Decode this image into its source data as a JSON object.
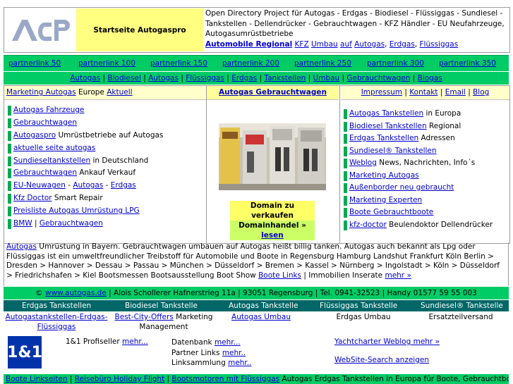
{
  "header": {
    "logo_text": "ACP",
    "start_label": "Startseite Autogaspro",
    "odp_text": "Open Directory Project für Autogas - Erdgas - Biodiesel - Flüssiggas - Sundiesel - Tankstellen - Dellendrücker - Gebrauchtwagen - KFZ Händler - EU Neufahrzeuge, Autogasumrüstbetriebe",
    "odp_links": [
      "Automobile Regional",
      "KFZ",
      "Umbau",
      "auf",
      "Autogas",
      "Erdgas",
      "Flüssiggas"
    ]
  },
  "partners": [
    "partnerlink 50",
    "partnerlink 100",
    "partnerlink 150",
    "partnerlink 200",
    "partnerlink 250",
    "partnerlink 300",
    "partnerlink 350"
  ],
  "categories": [
    "Autogas",
    "Biodiesel",
    "Autogas",
    "Flüssiggas",
    "Erdgas",
    "Tankstellen",
    "Umbau",
    "Gebrauchtwagen",
    "Biogas"
  ],
  "col_heads": {
    "left_link1": "Marketing Autogas",
    "left_text": "Europe",
    "left_link2": "Aktuell",
    "center": "Autogas Gebrauchtwagen",
    "right": [
      "Impressum",
      "Kontakt",
      "Email",
      "Blog"
    ]
  },
  "left_list": [
    {
      "link": "Autogas Fahrzeuge",
      "text": ""
    },
    {
      "link": "Gebrauchtwagen",
      "text": ""
    },
    {
      "link": "Autogaspro",
      "text": " Umrüstbetriebe auf Autogas"
    },
    {
      "link": "aktuelle seite autogas",
      "text": ""
    },
    {
      "link": "Sundieseltankstellen",
      "text": " in Deutschland"
    },
    {
      "link": "Gebrauchtwagen",
      "text": " Ankauf Verkauf"
    },
    {
      "link": "EU-Neuwagen",
      "text": " - ",
      "link2": "Autogas",
      "text2": " - ",
      "link3": "Erdgas"
    },
    {
      "link": "Kfz Doctor",
      "text": " Smart Repair"
    },
    {
      "link": "Preisliste Autogas Umrüstung LPG",
      "text": ""
    },
    {
      "link": "BMW",
      "text": " | ",
      "link2": "Gebrauchtwagen"
    }
  ],
  "right_list": [
    {
      "link": "Autogas Tankstellen",
      "text": " in Europa"
    },
    {
      "link": "Biodiesel Tankstellen",
      "text": " Regional"
    },
    {
      "link": "Erdgas Tankstellen",
      "text": " Adressen"
    },
    {
      "link": "Sundiesel® Tankstellen",
      "text": ""
    },
    {
      "link": "Weblog",
      "text": " News, Nachrichten, Info´s"
    },
    {
      "link": "Marketing Autogas",
      "text": ""
    },
    {
      "link": "Außenborder neu gebraucht",
      "text": ""
    },
    {
      "link": "Marketing Experten",
      "text": ""
    },
    {
      "link": "Boote Gebrauchtboote",
      "text": ""
    },
    {
      "link": "kfz-doctor",
      "text": " Beulendoktor Dellendrücker"
    }
  ],
  "domain": {
    "line1": "Domain zu verkaufen",
    "line2": "Domainhandel",
    "line2_arrow": "»",
    "line2_link": "lesen"
  },
  "body_text": {
    "link": "Autogas",
    "text": " Umrüstung in Bayern. Gebrauchtwagen umbauen auf  Autogas heißt billig tanken. Autogas auch bekannt als Lpg oder Flüssiggas ist ein umweltfreundlicher Treibstoff für Automobile und Boote in Regensburg  Hamburg Landshut Frankfurt Köln  Berlin > Dresden > Hannover > Dessau > Passau > München > Düsseldorf > Bremen > Kassel > Nürnberg > Ingolstadt > Köln > Düsseldorf > Friedrichshafen > Kiel Bootsmessen Bootsausstellung Boot Show ",
    "link2": "Boote Links",
    "text2": " | Immobilien Inserate ",
    "link3": "mehr »"
  },
  "copyright": {
    "pre": "© ",
    "link": "www.autogas.de",
    "post": " | Alois Schollerer  Hafnerstrieg 11a | 93051 Regensburg | Tel. 0941-32523 | Handy 01577 59 55 003"
  },
  "nav": [
    "Erdgas Tankstellen",
    "Biodiesel Tankstelle",
    "Autogas Tankstelle",
    "Flüssiggas Tankstelle",
    "Sundiesel® Tankstelle"
  ],
  "row2": {
    "c1_link": "Autogastankstellen-Erdgas-Flüssiggas",
    "c2_link": "Best-City-Offers",
    "c2_text": " Marketing Management",
    "c3_link": "Autogas Umbau",
    "c4_text": "Erdgas Umbau",
    "c5_text": "Ersatzteilversand"
  },
  "bottom": {
    "logo": "1&1",
    "prof_text": "1&1 Profiseller ",
    "prof_link": "mehr...",
    "dn_text": "Datenbank ",
    "dn_link": "mehr...",
    "pl_text": "Partner Links ",
    "pl_link": "mehr..",
    "ls_text": "Linksammlung ",
    "ls_link": "mehr..",
    "yacht": "Yachtcharter Weblog mehr »",
    "web": "WebSite-Search anzeigen"
  },
  "footer": {
    "links": [
      "Boote Linkseiten",
      "Reisebüro Holiday Flight",
      "Bootsmotoren mit Flüssiggas"
    ],
    "text": " Autogas Erdgas Tankstellen in Europa für Boote, Gebrauchtboote |"
  }
}
